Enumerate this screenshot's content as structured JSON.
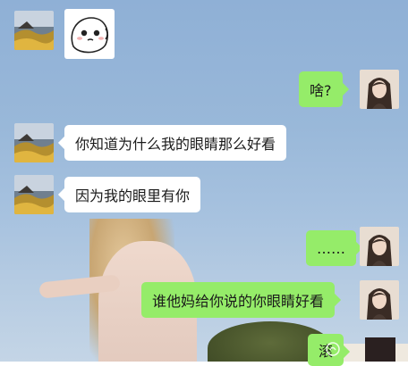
{
  "chat": {
    "messages": [
      {
        "side": "received",
        "type": "sticker",
        "sticker": "cartoon-shy-face-sticker"
      },
      {
        "side": "sent",
        "text": "啥?"
      },
      {
        "side": "received",
        "text": "你知道为什么我的眼睛那么好看"
      },
      {
        "side": "received",
        "text": "因为我的眼里有你"
      },
      {
        "side": "sent",
        "text": "……"
      },
      {
        "side": "sent",
        "text": "谁他妈给你说的你眼睛好看"
      },
      {
        "side": "sent",
        "text": "滚"
      }
    ]
  },
  "colors": {
    "sent_bubble": "#95ec69",
    "received_bubble": "#ffffff",
    "background": "#9bb8d8"
  },
  "icons": {
    "received_avatar": "landscape-avatar",
    "sent_avatar": "girl-long-hair-avatar",
    "watermark": "watermark-logo-icon"
  }
}
